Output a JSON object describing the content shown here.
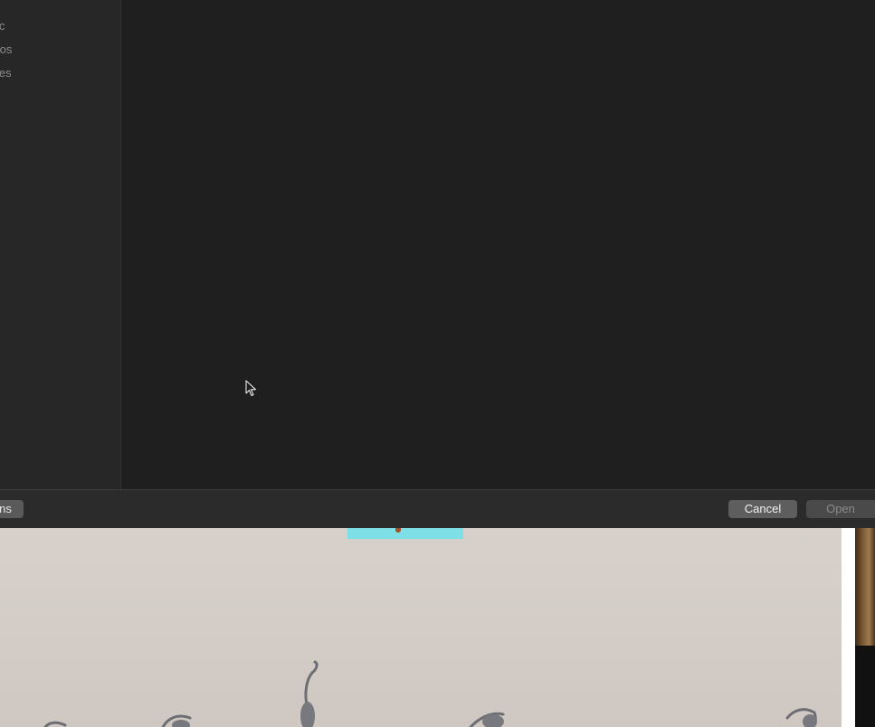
{
  "sidebar": {
    "items": [
      {
        "label": "ic"
      },
      {
        "label": "tos"
      },
      {
        "label": "ies"
      }
    ]
  },
  "footer": {
    "options_label": "ns",
    "cancel_label": "Cancel",
    "open_label": "Open"
  },
  "colors": {
    "dialog_bg": "#1f1f1f",
    "sidebar_bg": "#272727",
    "footer_bg": "#2b2b2b",
    "button_bg": "#5e5e5e",
    "button_disabled_text": "#8a8a8a"
  }
}
